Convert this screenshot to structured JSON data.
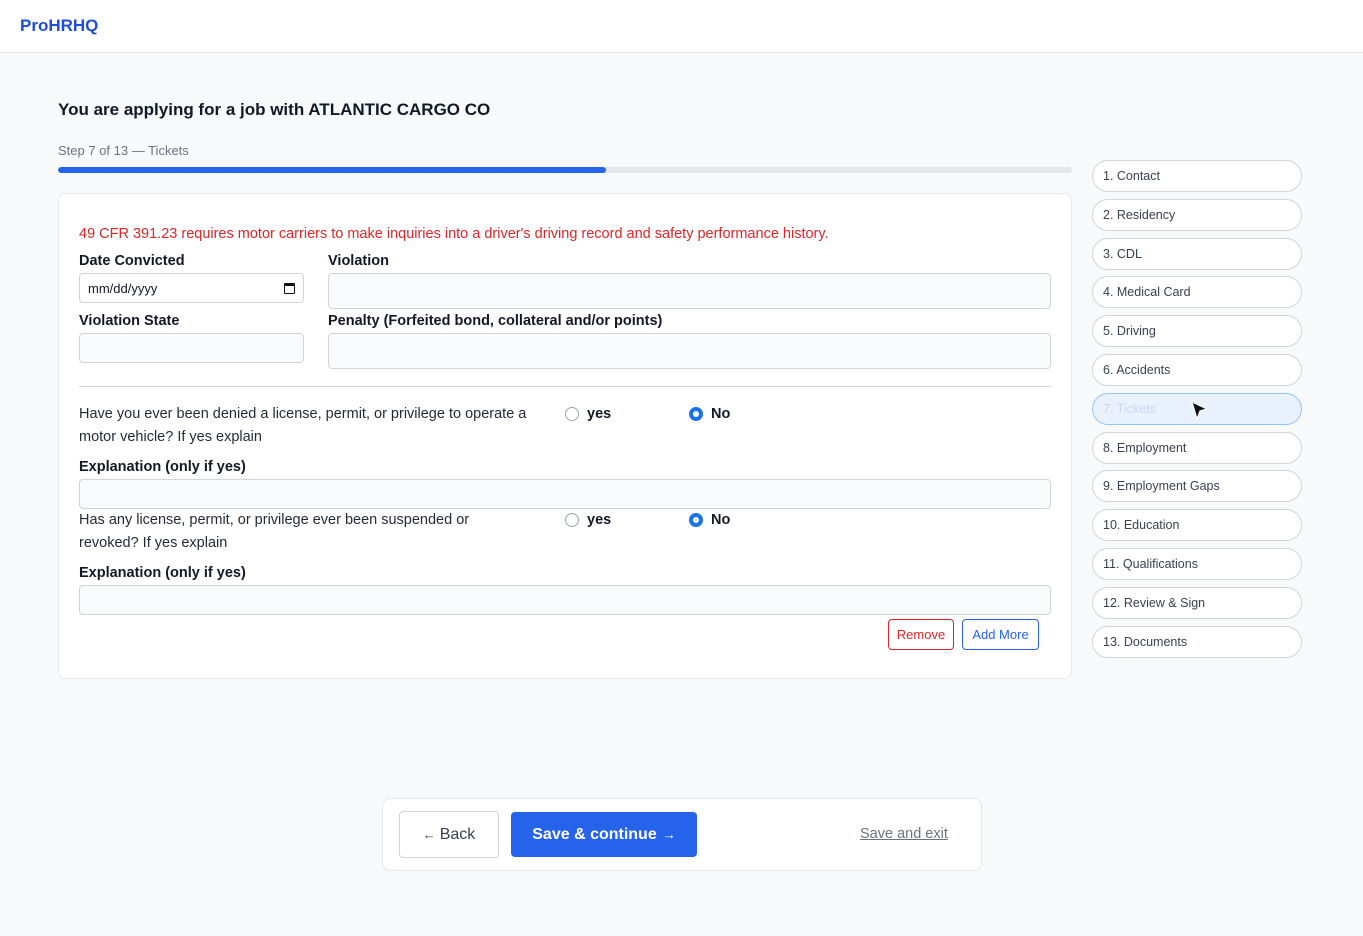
{
  "app": {
    "brand": "ProHRHQ"
  },
  "page": {
    "heading": "You are applying for a job with ATLANTIC CARGO CO",
    "step_label": "Step 7 of 13 — Tickets",
    "progress": 0.54
  },
  "form": {
    "notice": "49 CFR 391.23 requires motor carriers to make inquiries into a driver's driving record and safety performance history.",
    "date_convicted_label": "Date Convicted",
    "date_placeholder": "mm/dd/yyyy",
    "violation_label": "Violation",
    "violation_state_label": "Violation State",
    "penalty_label": "Penalty (Forfeited bond, collateral and/or points)",
    "q1": {
      "text": "Have you ever been denied a license, permit, or privilege to operate a motor vehicle? If yes explain",
      "yes_label": "yes",
      "no_label": "No",
      "selected": "No",
      "explanation_label": "Explanation (only if yes)"
    },
    "q2": {
      "text": "Has any license, permit, or privilege ever been suspended or revoked? If yes explain",
      "yes_label": "yes",
      "no_label": "No",
      "selected": "No",
      "explanation_label": "Explanation (only if yes)"
    },
    "remove_label": "Remove",
    "add_more_label": "Add More"
  },
  "steps": [
    {
      "label": "1. Contact"
    },
    {
      "label": "2. Residency"
    },
    {
      "label": "3. CDL"
    },
    {
      "label": "4. Medical Card"
    },
    {
      "label": "5. Driving"
    },
    {
      "label": "6. Accidents"
    },
    {
      "label": "7. Tickets",
      "active": true
    },
    {
      "label": "8. Employment"
    },
    {
      "label": "9. Employment Gaps"
    },
    {
      "label": "10. Education"
    },
    {
      "label": "11. Qualifications"
    },
    {
      "label": "12. Review & Sign"
    },
    {
      "label": "13. Documents"
    }
  ],
  "footer": {
    "back_label": "Back",
    "back_arrow": "←",
    "save_label": "Save & continue",
    "save_arrow": "→",
    "exit_label": "Save and exit"
  },
  "colors": {
    "accent": "#2563eb",
    "danger": "#dc2626",
    "brand": "#1d4ed8"
  }
}
